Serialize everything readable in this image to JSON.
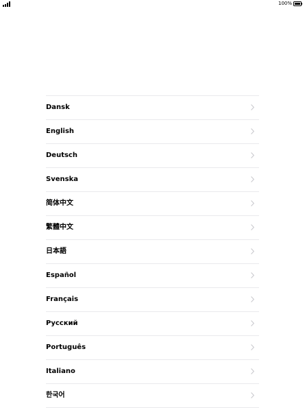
{
  "status_bar": {
    "battery_percent": "100%",
    "icons": [
      "signal-icon",
      "battery-icon"
    ]
  },
  "language_list": {
    "chevron_icon": "chevron-right-icon",
    "chevron_color": "#c7c7cc",
    "separator_color": "#e9e9ec",
    "items": [
      {
        "label": "Dansk"
      },
      {
        "label": "English"
      },
      {
        "label": "Deutsch"
      },
      {
        "label": "Svenska"
      },
      {
        "label": "简体中文"
      },
      {
        "label": "繁體中文"
      },
      {
        "label": "日本語"
      },
      {
        "label": "Español"
      },
      {
        "label": "Français"
      },
      {
        "label": "Русский"
      },
      {
        "label": "Português"
      },
      {
        "label": "Italiano"
      },
      {
        "label": "한국어"
      }
    ]
  }
}
